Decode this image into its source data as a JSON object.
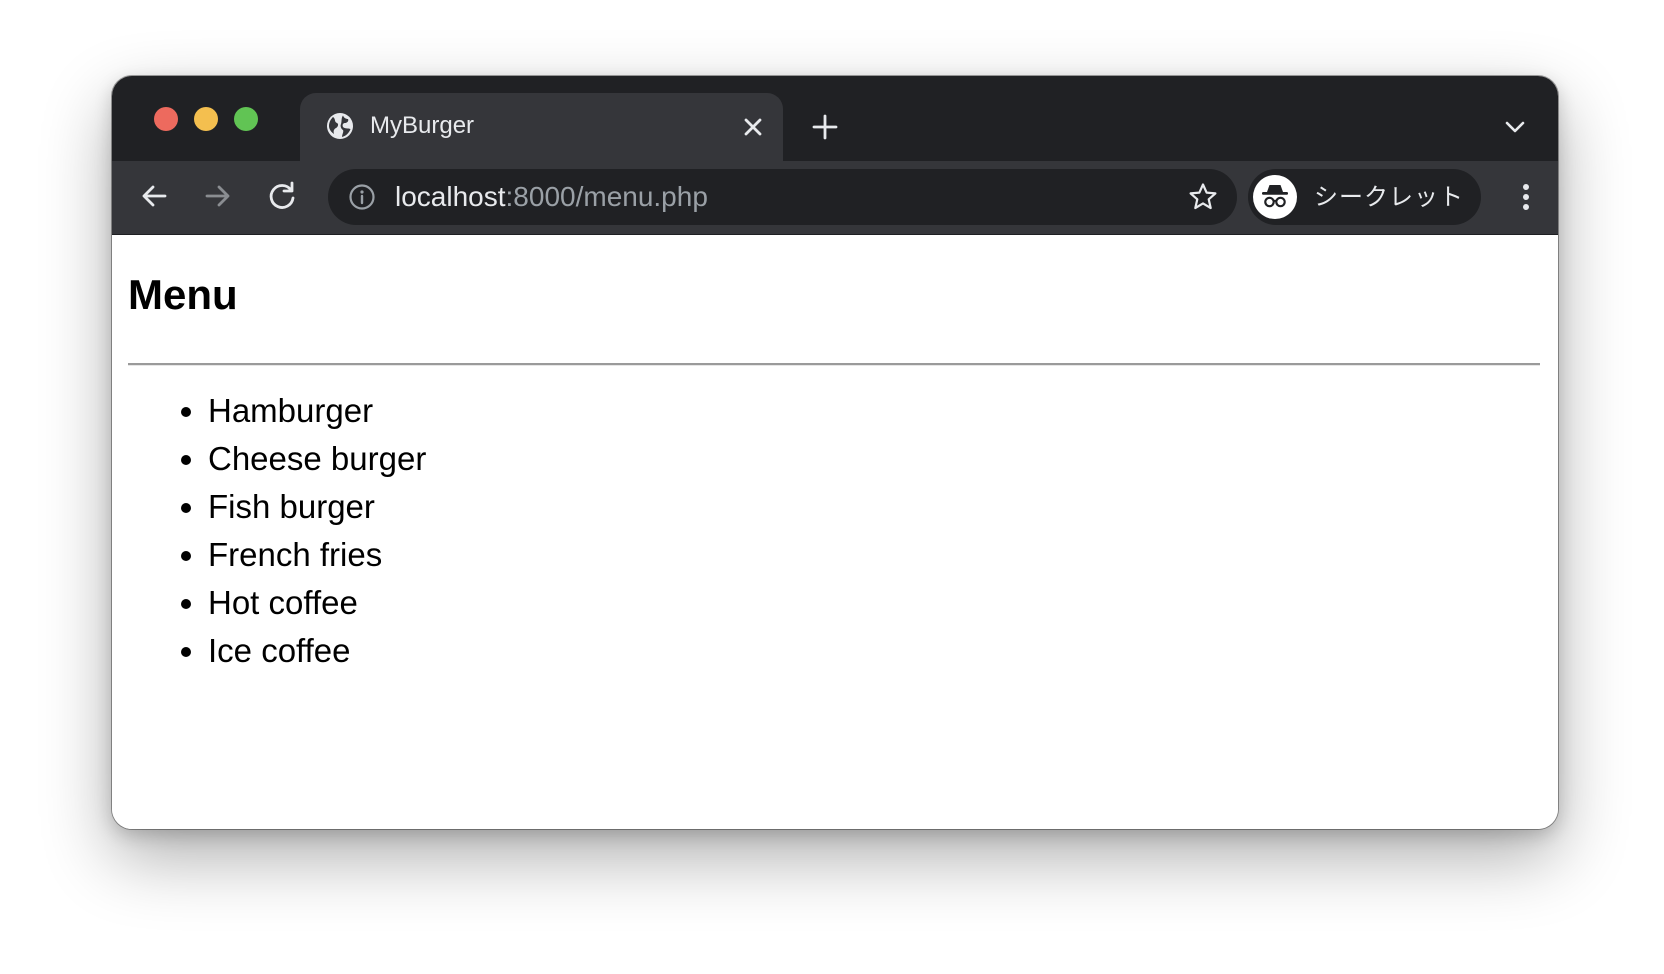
{
  "browser": {
    "tab": {
      "title": "MyBurger",
      "favicon": "globe-icon",
      "close": "close-icon"
    },
    "new_tab": "plus-icon",
    "tab_search": "chevron-down-icon",
    "toolbar": {
      "back": "arrow-left-icon",
      "forward": "arrow-right-icon",
      "reload": "reload-icon",
      "site_info": "info-icon",
      "url_host": "localhost",
      "url_rest": ":8000/menu.php",
      "bookmark": "star-icon",
      "profile_label": "シークレット",
      "profile_icon": "incognito-icon",
      "menu": "more-vert-icon"
    },
    "colors": {
      "tabstrip": "#202124",
      "toolbar": "#35363a",
      "omnibox": "#202124",
      "text_light": "#e8eaed",
      "text_dim": "#9aa0a6",
      "close_red": "#ed6a5e",
      "minimize_yellow": "#f4bf4f",
      "maximize_green": "#61c454"
    }
  },
  "page": {
    "title": "Menu",
    "items": [
      "Hamburger",
      "Cheese burger",
      "Fish burger",
      "French fries",
      "Hot coffee",
      "Ice coffee"
    ]
  }
}
